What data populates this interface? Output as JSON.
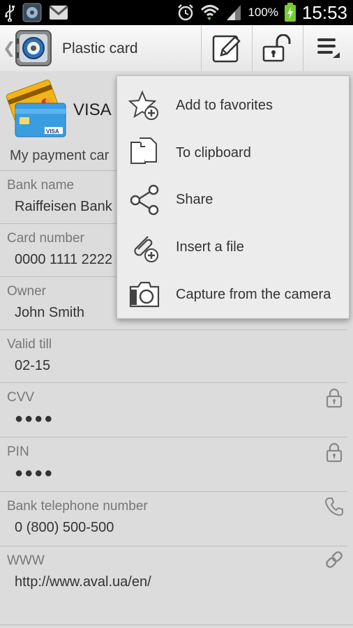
{
  "status_bar": {
    "battery": "100%",
    "time": "15:53"
  },
  "action_bar": {
    "title": "Plastic card"
  },
  "card": {
    "type": "VISA",
    "description": "My payment car"
  },
  "fields": [
    {
      "label": "Bank name",
      "value": "Raiffeisen Bank"
    },
    {
      "label": "Card number",
      "value": "0000 1111 2222"
    },
    {
      "label": "Owner",
      "value": "John Smith"
    },
    {
      "label": "Valid till",
      "value": "02-15"
    },
    {
      "label": "CVV",
      "value": "●●●●"
    },
    {
      "label": "PIN",
      "value": "●●●●"
    },
    {
      "label": "Bank telephone number",
      "value": "0 (800) 500-500"
    },
    {
      "label": "WWW",
      "value": "http://www.aval.ua/en/"
    }
  ],
  "menu": {
    "items": [
      {
        "label": "Add to favorites",
        "icon": "star-add-icon"
      },
      {
        "label": "To clipboard",
        "icon": "copy-icon"
      },
      {
        "label": "Share",
        "icon": "share-icon"
      },
      {
        "label": "Insert a file",
        "icon": "attach-icon"
      },
      {
        "label": "Capture from the camera",
        "icon": "camera-icon"
      }
    ]
  }
}
